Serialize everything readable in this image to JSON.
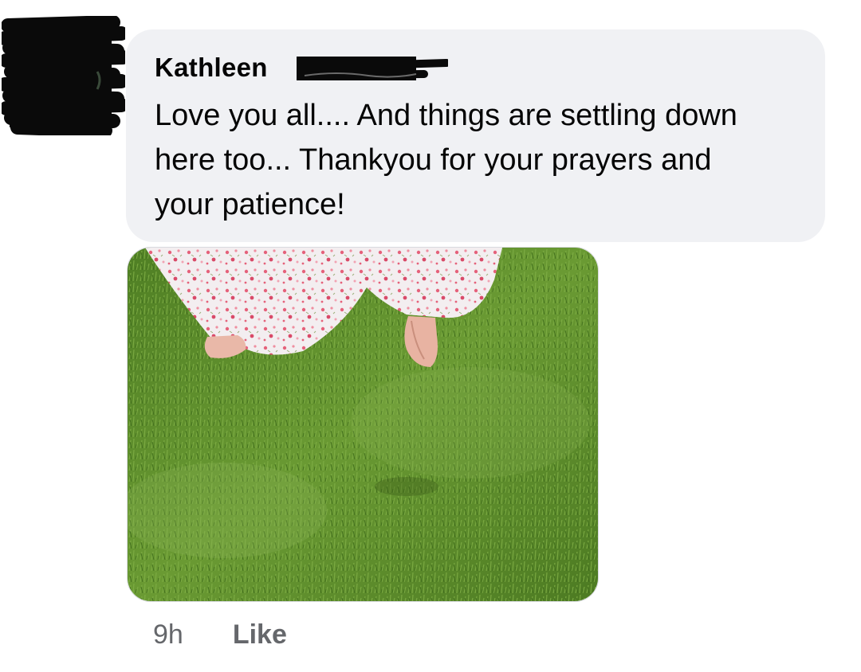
{
  "comment": {
    "author_name": "Kathleen",
    "text": "Love you all.... And things are settling down here too... Thankyou for your prayers and your patience!",
    "timestamp": "9h",
    "like_label": "Like"
  },
  "colors": {
    "bubble_bg": "#f0f1f4",
    "text": "#050505",
    "meta_text": "#65676b",
    "redaction": "#0a0a0a",
    "grass": "#5a8a2c"
  },
  "attachment": {
    "icon": "photo-attachment"
  }
}
